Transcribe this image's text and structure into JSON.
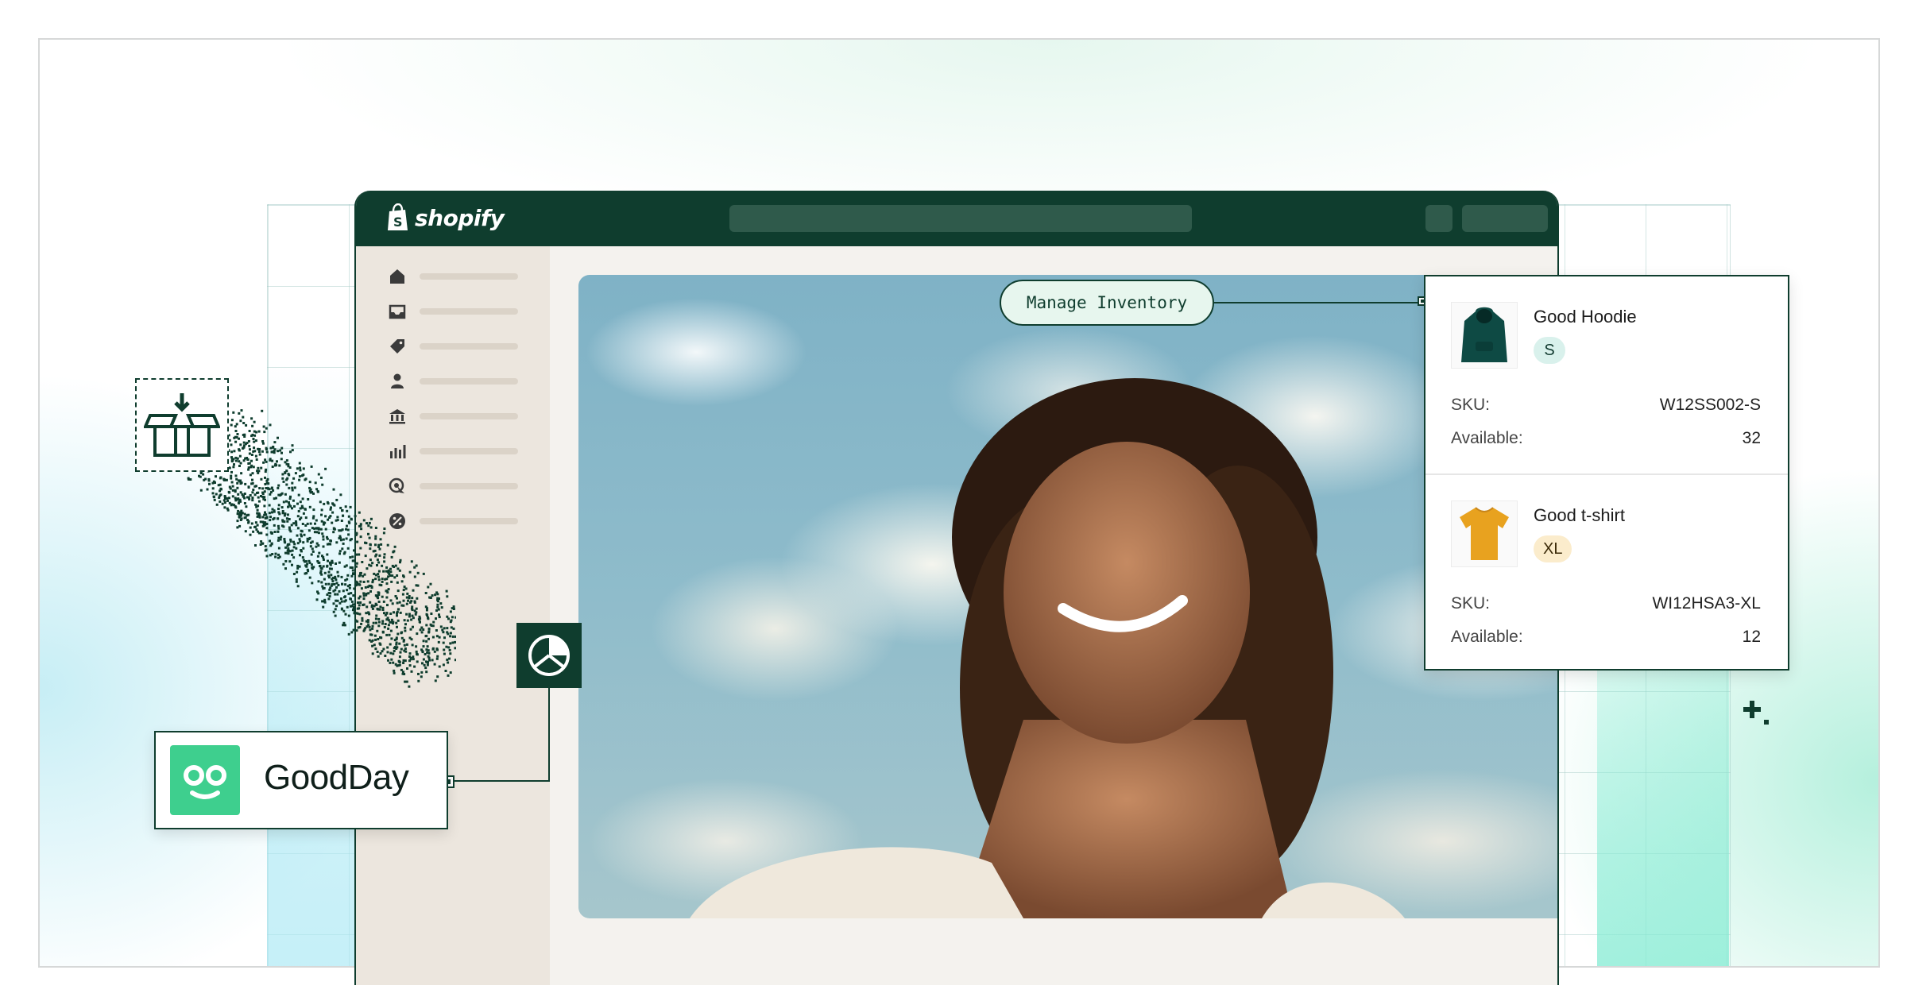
{
  "app": {
    "brand": "shopify"
  },
  "colors": {
    "dark_green": "#0f3d2e",
    "mint": "#3ecf8e",
    "badge_teal": "#d9f1ec",
    "badge_yellow": "#fbeccc"
  },
  "sidebar": {
    "items": [
      {
        "icon": "home-icon"
      },
      {
        "icon": "inbox-icon"
      },
      {
        "icon": "tag-icon"
      },
      {
        "icon": "person-icon"
      },
      {
        "icon": "bank-icon"
      },
      {
        "icon": "bar-chart-icon"
      },
      {
        "icon": "target-icon"
      },
      {
        "icon": "discount-icon"
      }
    ]
  },
  "callout": {
    "label": "Manage Inventory"
  },
  "inventory": {
    "products": [
      {
        "name": "Good Hoodie",
        "size": "S",
        "sku_label": "SKU:",
        "sku": "W12SS002-S",
        "available_label": "Available:",
        "available": "32",
        "image": "hoodie-icon"
      },
      {
        "name": "Good t-shirt",
        "size": "XL",
        "sku_label": "SKU:",
        "sku": "WI12HSA3-XL",
        "available_label": "Available:",
        "available": "12",
        "image": "tshirt-icon"
      }
    ]
  },
  "partner": {
    "name": "GoodDay"
  }
}
